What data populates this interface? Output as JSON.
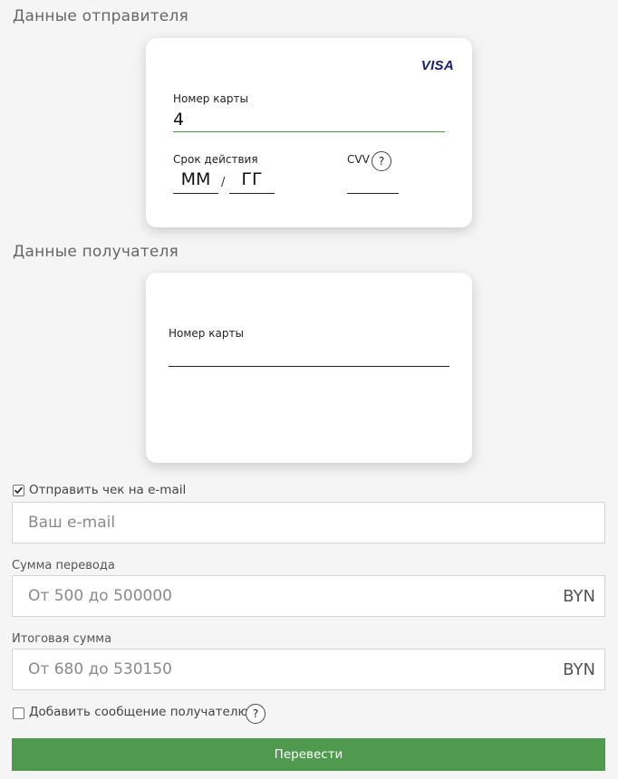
{
  "sender": {
    "title": "Данные отправителя",
    "brand": "VISA",
    "card_number_label": "Номер карты",
    "card_number_value": "4",
    "expiry_label": "Срок действия",
    "month_value": "ММ",
    "year_value": "ГГ",
    "separator": "/",
    "cvv_label": "CVV",
    "help_symbol": "?"
  },
  "receiver": {
    "title": "Данные получателя",
    "card_number_label": "Номер карты",
    "card_number_value": ""
  },
  "email": {
    "checkbox_label": "Отправить чек на e-mail",
    "checked": true,
    "placeholder": "Ваш e-mail"
  },
  "amount": {
    "label": "Сумма перевода",
    "placeholder": "От 500 до 500000",
    "currency": "BYN"
  },
  "total": {
    "label": "Итоговая сумма",
    "placeholder": "От 680 до 530150",
    "currency": "BYN"
  },
  "message": {
    "checkbox_label": "Добавить сообщение получателю",
    "checked": false,
    "help_symbol": "?"
  },
  "submit": {
    "label": "Перевести"
  },
  "colors": {
    "accent_green": "#4f9a4f",
    "visa_blue": "#1a1f71"
  }
}
